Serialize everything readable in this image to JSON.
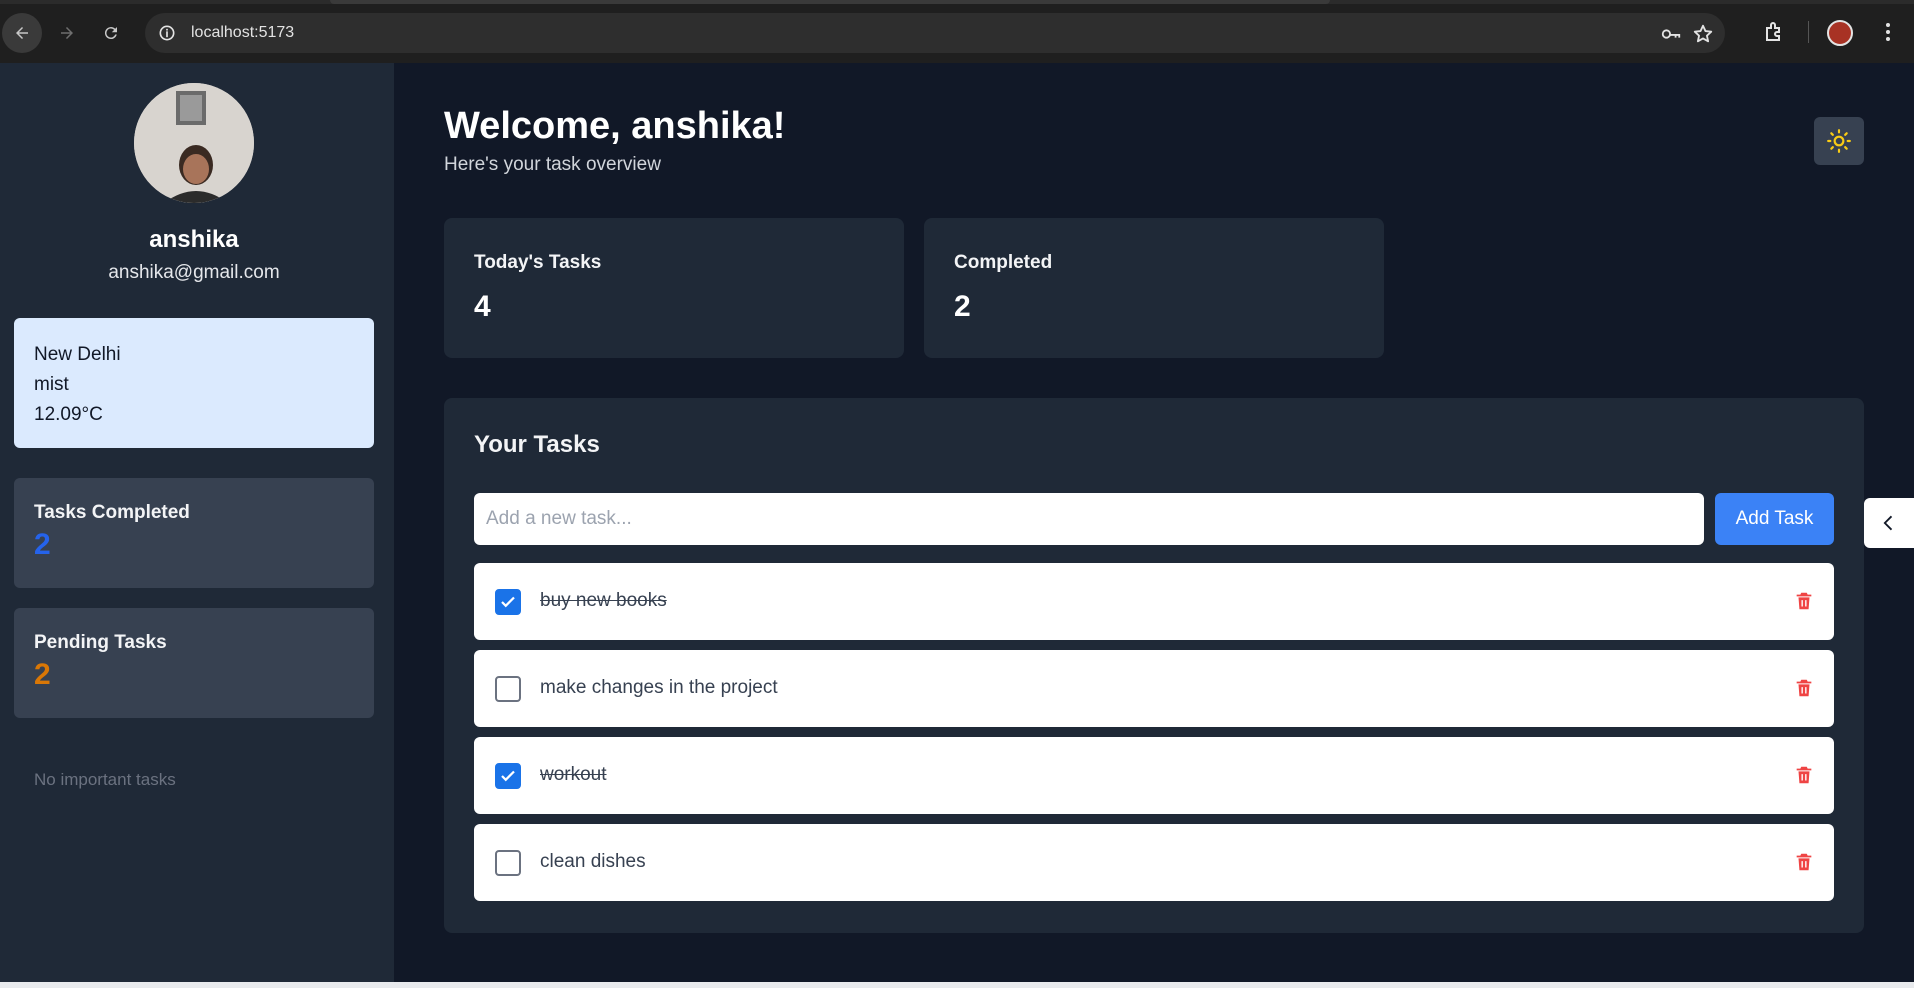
{
  "browser": {
    "url": "localhost:5173",
    "icons": [
      "back-icon",
      "forward-icon",
      "reload-icon",
      "site-info-icon",
      "key-icon",
      "star-icon",
      "extensions-icon",
      "profile-avatar",
      "menu-icon"
    ]
  },
  "sidebar": {
    "user_name": "anshika",
    "user_email": "anshika@gmail.com",
    "weather": {
      "city": "New Delhi",
      "condition": "mist",
      "temperature": "12.09°C"
    },
    "stats": [
      {
        "label": "Tasks Completed",
        "value": "2",
        "color": "#2563eb"
      },
      {
        "label": "Pending Tasks",
        "value": "2",
        "color": "#d97706"
      }
    ],
    "important_empty": "No important tasks"
  },
  "main": {
    "welcome": "Welcome, anshika!",
    "subtitle": "Here's your task overview",
    "summary": [
      {
        "label": "Today's Tasks",
        "value": "4"
      },
      {
        "label": "Completed",
        "value": "2"
      }
    ],
    "tasks_title": "Your Tasks",
    "task_input": {
      "placeholder": "Add a new task...",
      "value": ""
    },
    "add_button": "Add Task",
    "tasks": [
      {
        "text": "buy new books",
        "completed": true
      },
      {
        "text": "make changes in the project",
        "completed": false
      },
      {
        "text": "workout",
        "completed": true
      },
      {
        "text": "clean dishes",
        "completed": false
      }
    ]
  },
  "colors": {
    "accent": "#3b82f6",
    "background": "#111827",
    "panel": "#1f2937",
    "delete": "#ef4444"
  }
}
